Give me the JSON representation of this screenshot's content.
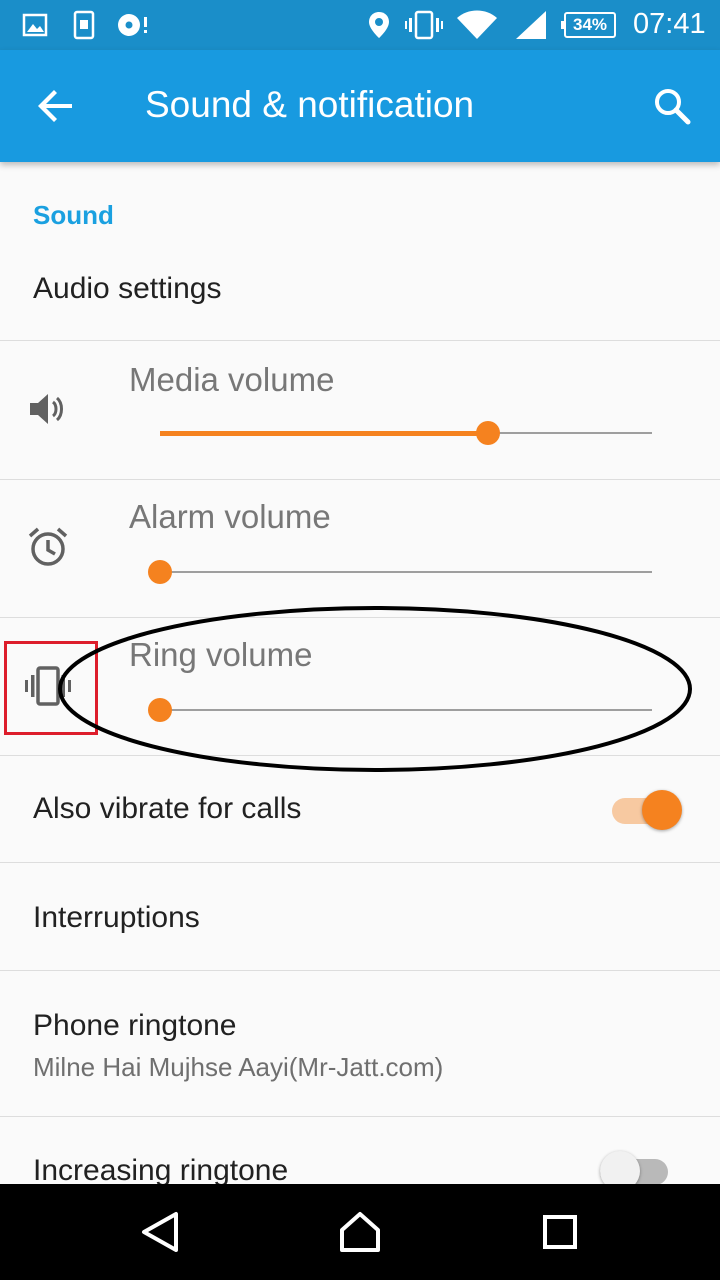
{
  "status_bar": {
    "battery": "34%",
    "time": "07:41",
    "icons": [
      "gallery-icon",
      "phone-download-icon",
      "music-icon",
      "location-icon",
      "vibrate-icon",
      "wifi-icon",
      "signal-icon",
      "battery-icon"
    ]
  },
  "app_bar": {
    "title": "Sound & notification",
    "back_icon": "arrow-back-icon",
    "search_icon": "search-icon"
  },
  "section": {
    "header": "Sound"
  },
  "items": {
    "audio_settings": "Audio settings",
    "media_volume": {
      "label": "Media volume",
      "level": 0.666,
      "icon": "speaker-icon"
    },
    "alarm_volume": {
      "label": "Alarm volume",
      "level": 0.0,
      "icon": "alarm-clock-icon"
    },
    "ring_volume": {
      "label": "Ring volume",
      "level": 0.0,
      "icon": "vibrate-icon"
    },
    "also_vibrate": {
      "label": "Also vibrate for calls",
      "on": true
    },
    "interruptions": "Interruptions",
    "phone_ringtone": {
      "title": "Phone ringtone",
      "value": "Milne Hai Mujhse Aayi(Mr-Jatt.com)"
    },
    "increasing_ringtone": {
      "label": "Increasing ringtone",
      "on": false
    }
  },
  "colors": {
    "accent": "#f5821f",
    "app_bar": "#189ae0",
    "status_bar": "#1a8ec9",
    "section_header": "#1aa0e0",
    "annotation_box": "#dd1d2b"
  },
  "nav_bar": {
    "back": "nav-back-icon",
    "home": "nav-home-icon",
    "recents": "nav-recents-icon"
  }
}
